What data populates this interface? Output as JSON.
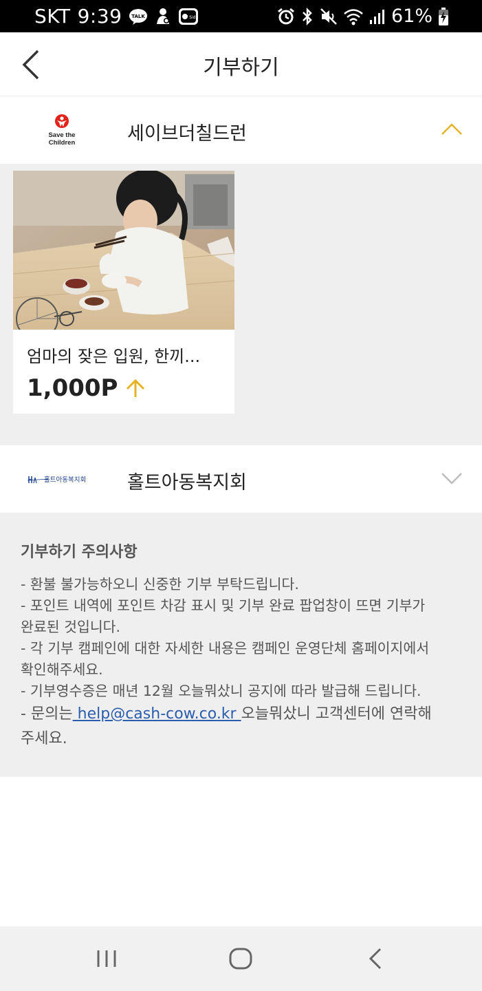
{
  "status_bar": {
    "carrier": "SKT",
    "time": "9:39",
    "talk_badge": "TALK",
    "tside_badge": "T Side",
    "battery": "61%"
  },
  "header": {
    "title": "기부하기"
  },
  "organizations": [
    {
      "name": "세이브더칠드런",
      "logo_text_line1": "Save the",
      "logo_text_line2": "Children",
      "expanded": true,
      "campaigns": [
        {
          "title": "엄마의 잦은 입원, 한끼...",
          "points": "1,000P"
        }
      ]
    },
    {
      "name": "홀트아동복지회",
      "logo_text": "홀트아동복지회",
      "expanded": false
    }
  ],
  "notice": {
    "title": "기부하기 주의사항",
    "line1": "- 환불 불가능하오니 신중한 기부 부탁드립니다.",
    "line2": "- 포인트 내역에 포인트 차감 표시 및 기부 완료 팝업창이 뜨면 기부가",
    "line3": "완료된 것입니다.",
    "line4": "- 각 기부 캠페인에 대한 자세한 내용은 캠페인 운영단체 홈페이지에서",
    "line5": "확인해주세요.",
    "line6": "- 기부영수증은 매년 12월 오늘뭐샀니 공지에 따라 발급해 드립니다.",
    "line7_prefix": "- 문의는",
    "email": " help@cash-cow.co.kr ",
    "line7_suffix": "오늘뭐샀니 고객센터에 연락해",
    "line8": "주세요."
  },
  "colors": {
    "accent": "#e6b325",
    "gray_bg": "#efefef",
    "link": "#2a5db0",
    "save_children_red": "#e2231a",
    "holt_blue": "#1d3f8f"
  }
}
